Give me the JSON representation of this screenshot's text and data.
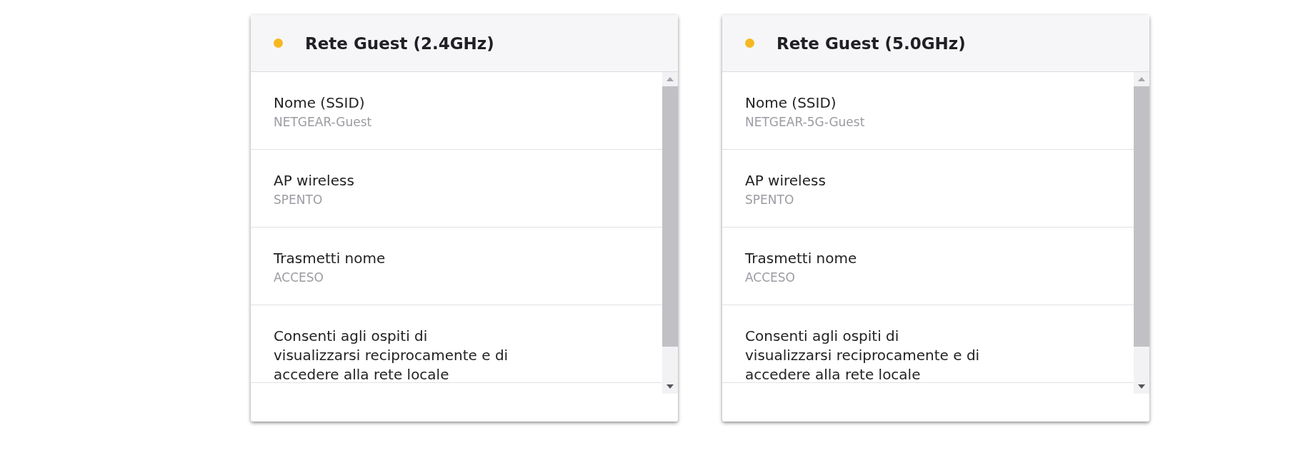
{
  "cards": [
    {
      "title": "Rete Guest (2.4GHz)",
      "color": "#f5b820",
      "rows": [
        {
          "label": "Nome (SSID)",
          "value": "NETGEAR-Guest"
        },
        {
          "label": "AP wireless",
          "value": "SPENTO"
        },
        {
          "label": "Trasmetti nome",
          "value": "ACCESO"
        },
        {
          "label": "Consenti agli ospiti di visualizzarsi reciprocamente e di accedere alla rete locale"
        }
      ]
    },
    {
      "title": "Rete Guest (5.0GHz)",
      "color": "#f5b820",
      "rows": [
        {
          "label": "Nome (SSID)",
          "value": "NETGEAR-5G-Guest"
        },
        {
          "label": "AP wireless",
          "value": "SPENTO"
        },
        {
          "label": "Trasmetti nome",
          "value": "ACCESO"
        },
        {
          "label": "Consenti agli ospiti di visualizzarsi reciprocamente e di accedere alla rete locale"
        }
      ]
    }
  ]
}
